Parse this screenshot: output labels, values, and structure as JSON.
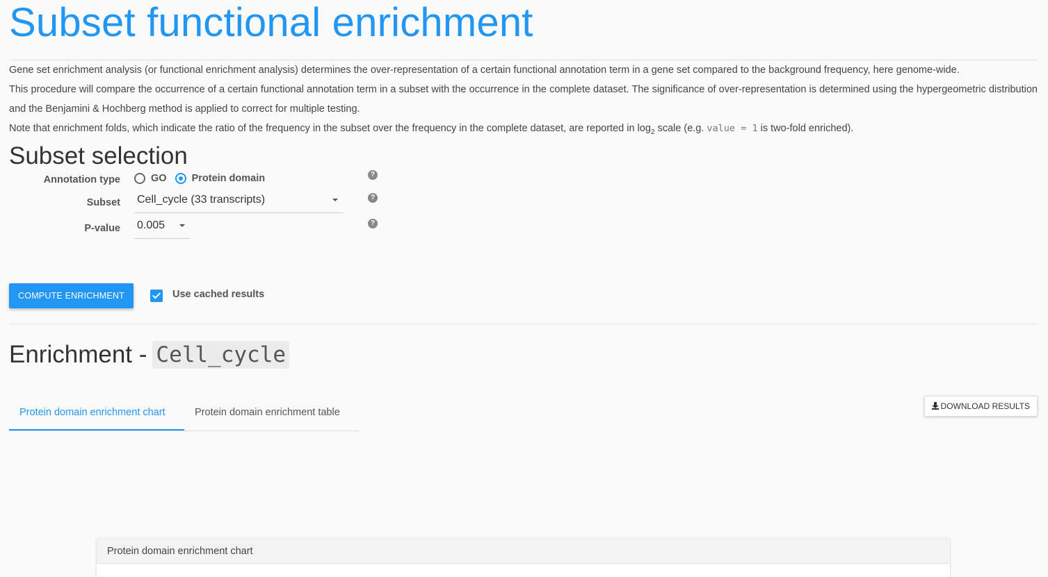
{
  "page": {
    "title": "Subset functional enrichment",
    "intro": {
      "p1": "Gene set enrichment analysis (or functional enrichment analysis) determines the over-representation of a certain functional annotation term in a gene set compared to the background frequency, here genome-wide.",
      "p2": "This procedure will compare the occurrence of a certain functional annotation term in a subset with the occurrence in the complete dataset. The significance of over-representation is determined using the hypergeometric distribution and the Benjamini & Hochberg method is applied to correct for multiple testing.",
      "p3_before": "Note that enrichment folds, which indicate the ratio of the frequency in the subset over the frequency in the complete dataset, are reported in log",
      "p3_sub": "2",
      "p3_mid": " scale (e.g. ",
      "p3_code": "value = 1",
      "p3_after": " is two-fold enriched)."
    }
  },
  "subset_selection": {
    "title": "Subset selection",
    "annotation_type": {
      "label": "Annotation type",
      "options": [
        "GO",
        "Protein domain"
      ],
      "selected": "Protein domain"
    },
    "subset": {
      "label": "Subset",
      "value": "Cell_cycle (33 transcripts)"
    },
    "pvalue": {
      "label": "P-value",
      "value": "0.005"
    },
    "help_glyph": "?",
    "compute_button": "COMPUTE ENRICHMENT",
    "use_cached": {
      "label": "Use cached results",
      "checked": true
    }
  },
  "enrichment": {
    "title_prefix": "Enrichment -",
    "subset_code": "Cell_cycle",
    "tabs": [
      {
        "label": "Protein domain enrichment chart",
        "active": true
      },
      {
        "label": "Protein domain enrichment table",
        "active": false
      }
    ],
    "download_button": "DOWNLOAD RESULTS",
    "panel_title": "Protein domain enrichment chart"
  },
  "colors": {
    "accent": "#2196f3",
    "background": "#fafafa"
  },
  "icons": [
    "help-icon",
    "chevron-down-icon",
    "checkmark-icon",
    "download-icon"
  ]
}
